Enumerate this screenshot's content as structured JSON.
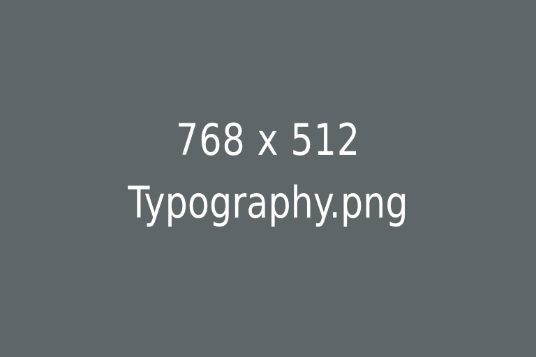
{
  "placeholder": {
    "dimensions": "768 x 512",
    "filename": "Typography.png",
    "background_color": "#5f6669",
    "text_color": "#ffffff"
  }
}
